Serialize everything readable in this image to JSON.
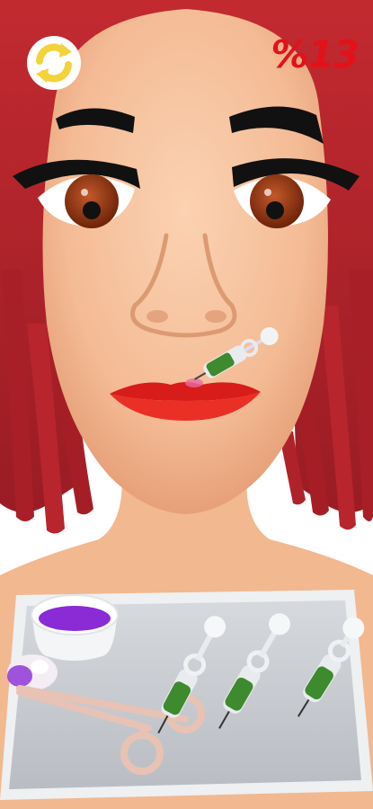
{
  "hud": {
    "restart_icon": "restart-arrows-icon",
    "progress_text": "%13",
    "progress_value_percent": 13
  },
  "colors": {
    "hair": "#b0222a",
    "skin": "#f6c19c",
    "lips": "#e2221d",
    "iris": "#9a3a17",
    "tray": "#c9cdd3",
    "tray_rim": "#eef0f2",
    "filler_purple": "#8a2bd6",
    "syringe_green": "#3e8a2e",
    "hud_red": "#e3121a",
    "hud_yellow": "#f3d33a"
  },
  "tools": {
    "syringes": [
      "syringe-1",
      "syringe-2",
      "syringe-3"
    ],
    "bowl": "filler-bowl",
    "tweezers": "tweezers-tool",
    "cotton": "cotton-ball"
  }
}
